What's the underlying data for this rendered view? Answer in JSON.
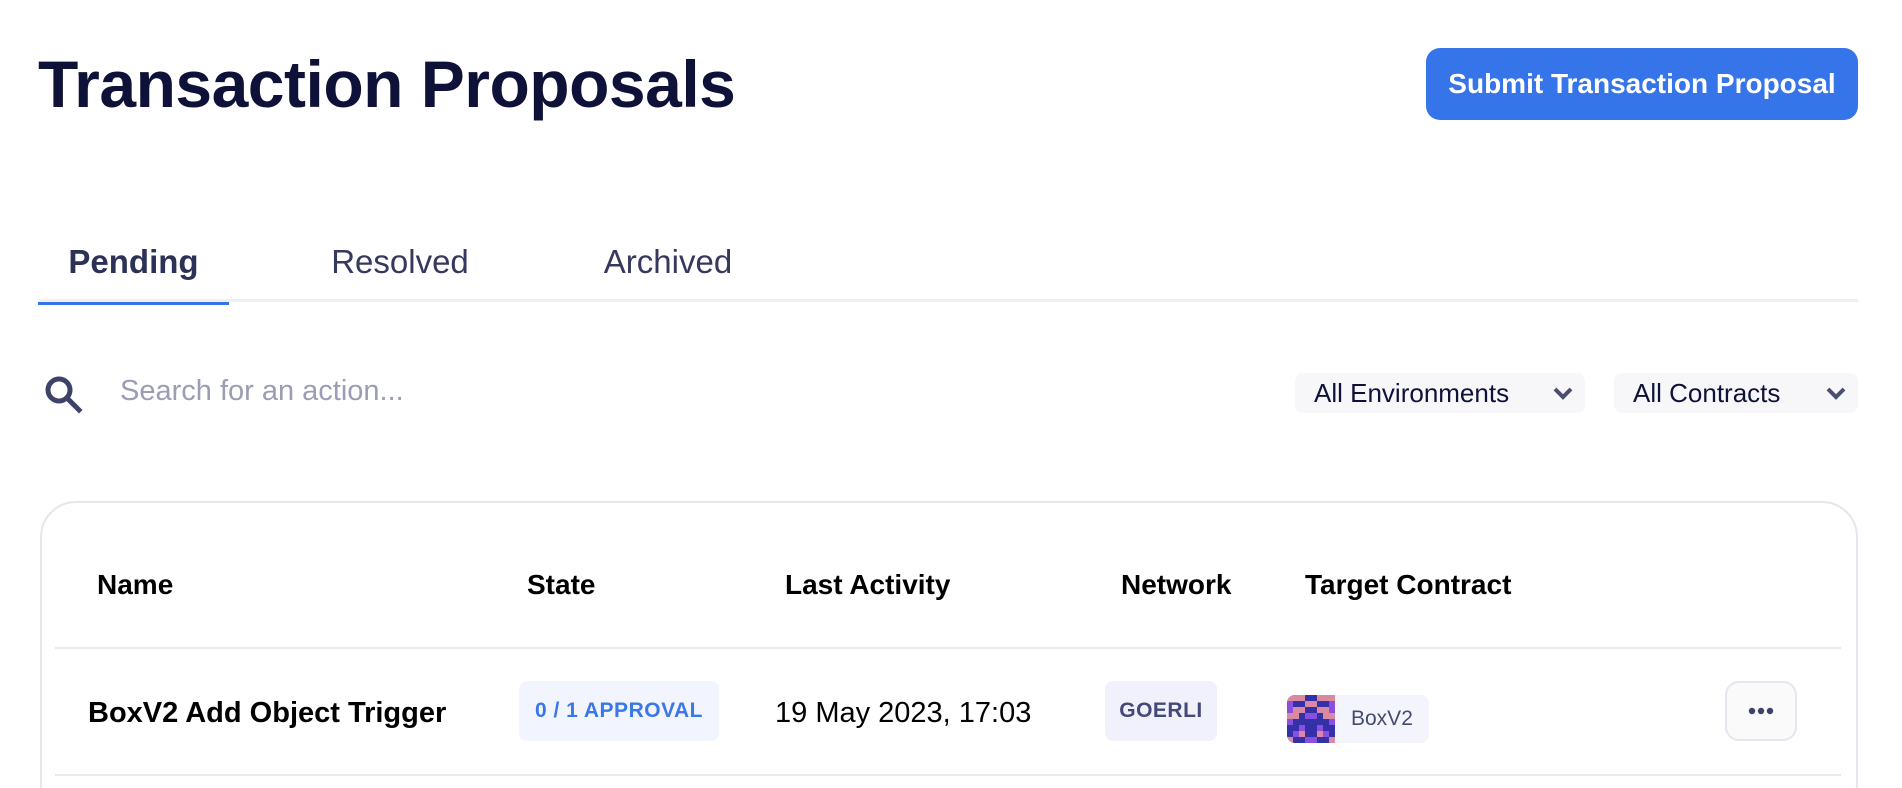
{
  "header": {
    "title": "Transaction Proposals",
    "submit_button_label": "Submit Transaction Proposal"
  },
  "tabs": [
    {
      "label": "Pending",
      "active": true
    },
    {
      "label": "Resolved",
      "active": false
    },
    {
      "label": "Archived",
      "active": false
    }
  ],
  "search": {
    "placeholder": "Search for an action...",
    "value": "",
    "icon": "search-icon"
  },
  "filters": {
    "environment": {
      "selected": "All Environments",
      "icon": "chevron-down-icon"
    },
    "contract": {
      "selected": "All Contracts",
      "icon": "chevron-down-icon"
    }
  },
  "table": {
    "columns": [
      "Name",
      "State",
      "Last Activity",
      "Network",
      "Target Contract"
    ],
    "rows": [
      {
        "name": "BoxV2 Add Object Trigger",
        "state": "0 / 1 APPROVAL",
        "last_activity": "19 May 2023, 17:03",
        "network": "GOERLI",
        "target_contract": "BoxV2",
        "actions_icon": "more-horizontal-icon"
      }
    ]
  },
  "colors": {
    "primary": "#3574e9",
    "title_text": "#0e1238",
    "state_badge_text": "#3a78ea",
    "network_badge_text": "#434a7a"
  }
}
